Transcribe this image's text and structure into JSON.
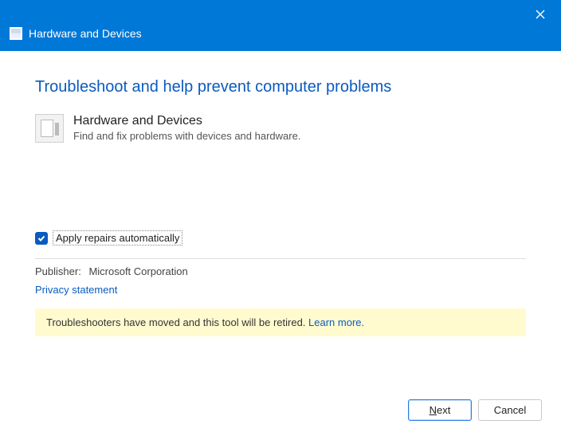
{
  "window": {
    "title": "Hardware and Devices"
  },
  "page": {
    "heading": "Troubleshoot and help prevent computer problems"
  },
  "category": {
    "name": "Hardware and Devices",
    "description": "Find and fix problems with devices and hardware."
  },
  "options": {
    "apply_repairs_label": "Apply repairs automatically",
    "apply_repairs_checked": true
  },
  "publisher": {
    "label": "Publisher:",
    "value": "Microsoft Corporation"
  },
  "links": {
    "privacy": "Privacy statement"
  },
  "banner": {
    "text": "Troubleshooters have moved and this tool will be retired. ",
    "link": "Learn more."
  },
  "buttons": {
    "next_prefix": "N",
    "next_rest": "ext",
    "cancel": "Cancel"
  }
}
